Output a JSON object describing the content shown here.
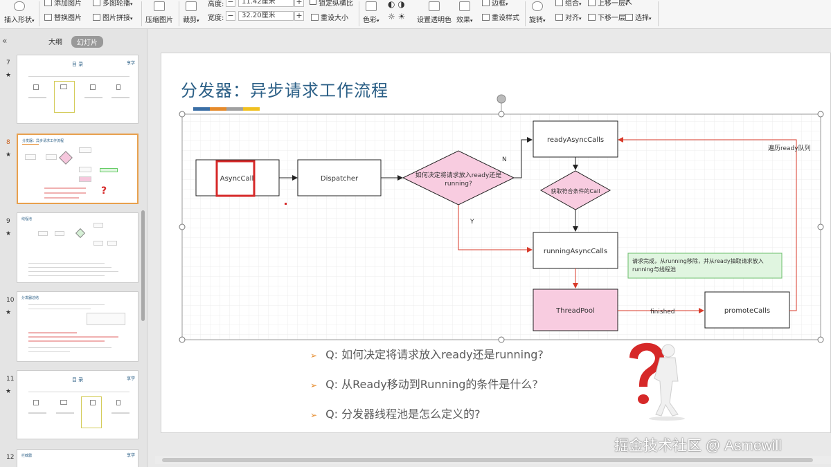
{
  "ribbon": {
    "insert_shape": "插入形状",
    "add_picture": "添加图片",
    "replace_picture": "替换图片",
    "multi_outline": "多图轮播",
    "picture_stitch": "图片拼接",
    "compress": "压缩图片",
    "crop": "裁剪",
    "height_label": "高度:",
    "height_value": "11.42厘米",
    "width_label": "宽度:",
    "width_value": "32.20厘米",
    "lock_ratio": "锁定纵横比",
    "reset_size": "重设大小",
    "color": "色彩",
    "set_transparent": "设置透明色",
    "effects": "效果",
    "border": "边框",
    "reset_style": "重设样式",
    "rotate": "旋转",
    "group": "组合",
    "align": "对齐",
    "bring_forward": "上移一层",
    "send_backward": "下移一层",
    "select": "选择"
  },
  "left_panel": {
    "collapse_icon": "«",
    "tab_outline": "大纲",
    "tab_slides": "幻灯片",
    "slides": [
      {
        "num": "7",
        "title": "目 录"
      },
      {
        "num": "8",
        "title": "分发器：异步请求工作流程"
      },
      {
        "num": "9",
        "title": "线程池"
      },
      {
        "num": "10",
        "title": "分发器总结"
      },
      {
        "num": "11",
        "title": "目 录"
      },
      {
        "num": "12",
        "title": "拦截器"
      }
    ],
    "star": "★"
  },
  "slide": {
    "title": "分发器：异步请求工作流程",
    "accent_colors": [
      "#3a6ea5",
      "#e58a2b",
      "#a0a0a0",
      "#f0c020"
    ],
    "diagram": {
      "async_call": "AsyncCall",
      "dispatcher": "Dispatcher",
      "decision": [
        "如何决定将请求放入ready还是",
        "running?"
      ],
      "ready_calls": "readyAsyncCalls",
      "get_call": "获取符合条件的Call",
      "running_calls": "runningAsyncCalls",
      "thread_pool": "ThreadPool",
      "promote_calls": "promoteCalls",
      "label_n": "N",
      "label_y": "Y",
      "label_finished": "finished",
      "label_iterate": "遍历ready队列",
      "note": [
        "请求完成，从running移除，并从ready抽取请求放入",
        "running与线程池"
      ]
    },
    "questions": [
      "Q: 如何决定将请求放入ready还是running?",
      "Q: 从Ready移动到Running的条件是什么?",
      "Q: 分发器线程池是怎么定义的?"
    ],
    "question_bullet": "➢"
  },
  "watermark": "掘金技术社区 @ Asmewill"
}
